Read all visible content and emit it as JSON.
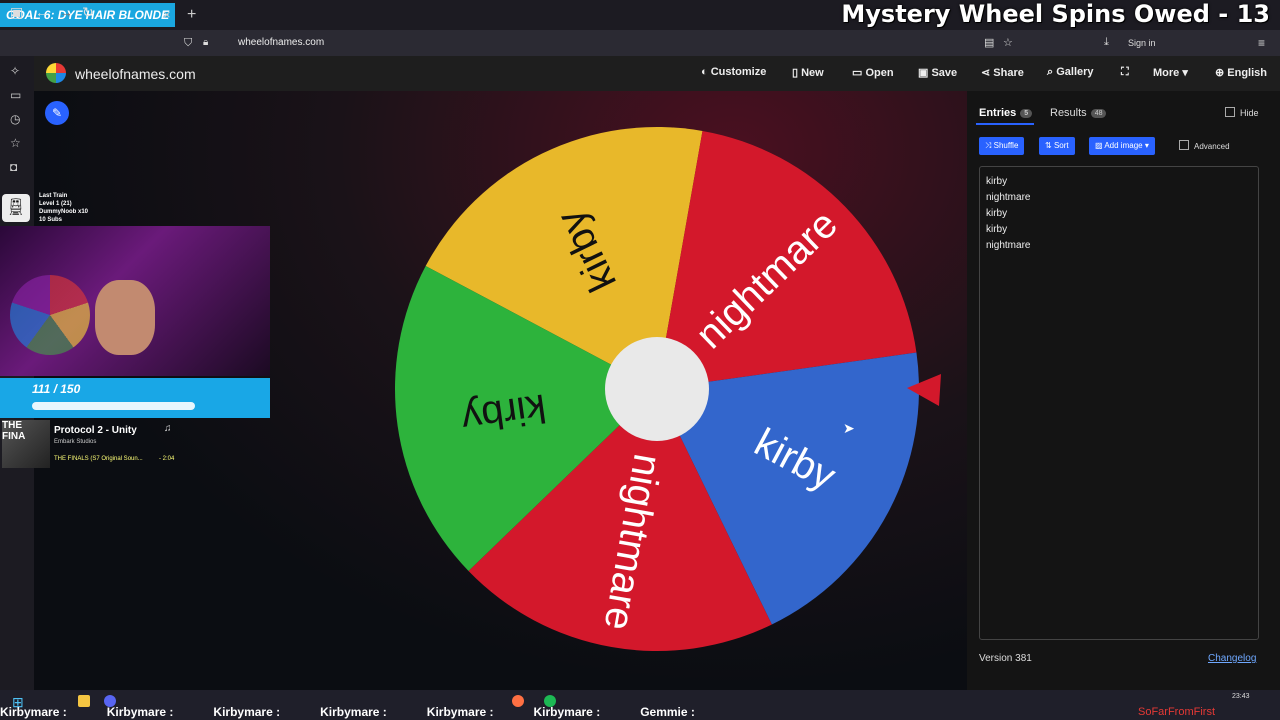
{
  "browser": {
    "tab_banner": "GOAL 6: DYE HAIR BLONDE",
    "tab_close": "×",
    "new_tab": "+",
    "url": "wheelofnames.com",
    "sign_in": "Sign in"
  },
  "overlay": {
    "title": "Mystery Wheel Spins Owed - 13",
    "train": {
      "title": "Last Train",
      "level": "Level 1 (21)",
      "user": "DummyNoob x10",
      "subs": "10 Subs"
    },
    "goal": {
      "text": "111 / 150",
      "progress": 0.74
    },
    "music": {
      "song": "Protocol 2 - Unity",
      "artist": "Embark Studios",
      "album": "THE FINALS (S7 Original Soun...",
      "time": "- 2:04"
    },
    "marquee": "Kirbymare :            Kirbymare :            Kirbymare :            Kirbymare :            Kirbymare :            Kirbymare :            Gemmie :",
    "sofarfromfirst": "SoFarFromFirst",
    "clock": "23:43"
  },
  "site": {
    "name": "wheelofnames.com",
    "menu": [
      "Customize",
      "New",
      "Open",
      "Save",
      "Share",
      "Gallery",
      "More",
      "English"
    ]
  },
  "wheel": {
    "segments": [
      {
        "label": "kirby",
        "color": "#e8b82a"
      },
      {
        "label": "nightmare",
        "color": "#d3182b"
      },
      {
        "label": "kirby",
        "color": "#3366cc"
      },
      {
        "label": "nightmare",
        "color": "#d3182b"
      },
      {
        "label": "kirby",
        "color": "#2db33c"
      }
    ],
    "pointer_color": "#d3182b"
  },
  "panel": {
    "tabs": {
      "entries": "Entries",
      "entries_count": "5",
      "results": "Results",
      "results_count": "48"
    },
    "hide": "Hide",
    "buttons": {
      "shuffle": "Shuffle",
      "sort": "Sort",
      "add_image": "Add image"
    },
    "advanced": "Advanced",
    "entries": [
      "kirby",
      "nightmare",
      "kirby",
      "kirby",
      "nightmare"
    ],
    "version": "Version 381",
    "changelog": "Changelog"
  }
}
